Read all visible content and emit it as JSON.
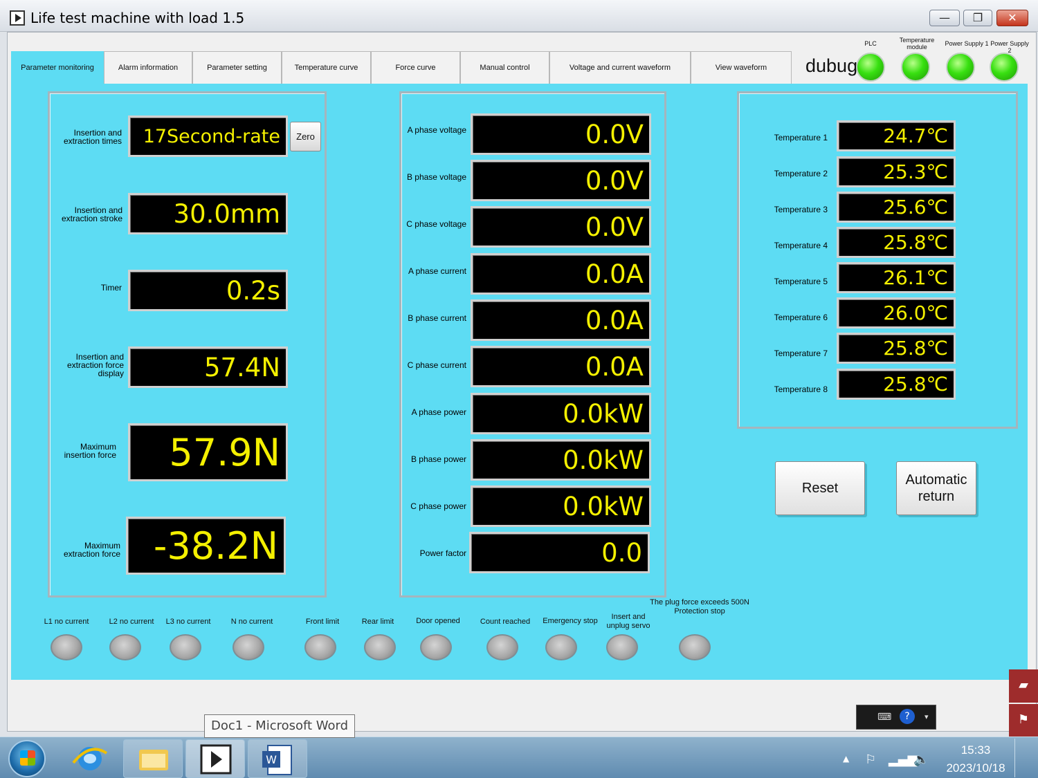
{
  "window": {
    "title": "Life test machine with load 1.5",
    "minimize_glyph": "—",
    "restore_glyph": "❐",
    "close_glyph": "✕"
  },
  "tabs": [
    {
      "label": "Parameter monitoring",
      "active": true
    },
    {
      "label": "Alarm information"
    },
    {
      "label": "Parameter setting"
    },
    {
      "label": "Temperature curve"
    },
    {
      "label": "Force curve"
    },
    {
      "label": "Manual control"
    },
    {
      "label": "Voltage and current waveform"
    },
    {
      "label": "View waveform"
    }
  ],
  "status": {
    "debug_text": "dubug",
    "plc_label": "PLC",
    "temp_module_label": "Temperature module",
    "psu1_label": "Power Supply 1",
    "psu2_label": "Power Supply 2",
    "led_color": "#38e011"
  },
  "left": {
    "insertion_times_label": "Insertion and extraction times",
    "insertion_times_value": "17Second-rate",
    "zero_label": "Zero",
    "stroke_label": "Insertion and extraction stroke",
    "stroke_value": "30.0mm",
    "timer_label": "Timer",
    "timer_value": "0.2s",
    "force_display_label": "Insertion and extraction force display",
    "force_display_value": "57.4N",
    "max_insertion_label": "Maximum insertion force",
    "max_insertion_value": "57.9N",
    "max_extraction_label": "Maximum extraction force",
    "max_extraction_value": "-38.2N"
  },
  "electrical": [
    {
      "label": "A phase voltage",
      "value": "0.0V"
    },
    {
      "label": "B phase voltage",
      "value": "0.0V"
    },
    {
      "label": "C phase voltage",
      "value": "0.0V"
    },
    {
      "label": "A phase current",
      "value": "0.0A"
    },
    {
      "label": "B phase current",
      "value": "0.0A"
    },
    {
      "label": "C phase current",
      "value": "0.0A"
    },
    {
      "label": "A phase power",
      "value": "0.0kW"
    },
    {
      "label": "B phase power",
      "value": "0.0kW"
    },
    {
      "label": "C phase power",
      "value": "0.0kW"
    },
    {
      "label": "Power factor",
      "value": "0.0"
    }
  ],
  "temperatures": [
    {
      "label": "Temperature 1",
      "value": "24.7℃"
    },
    {
      "label": "Temperature 2",
      "value": "25.3℃"
    },
    {
      "label": "Temperature 3",
      "value": "25.6℃"
    },
    {
      "label": "Temperature 4",
      "value": "25.8℃"
    },
    {
      "label": "Temperature 5",
      "value": "26.1℃"
    },
    {
      "label": "Temperature 6",
      "value": "26.0℃"
    },
    {
      "label": "Temperature 7",
      "value": "25.8℃"
    },
    {
      "label": "Temperature 8",
      "value": "25.8℃"
    }
  ],
  "buttons": {
    "reset": "Reset",
    "auto_return": "Automatic\nreturn"
  },
  "indicators": [
    {
      "label": "L1 no current"
    },
    {
      "label": "L2 no current"
    },
    {
      "label": "L3 no current"
    },
    {
      "label": "N no current"
    },
    {
      "label": "Front limit"
    },
    {
      "label": "Rear limit"
    },
    {
      "label": "Door opened"
    },
    {
      "label": "Count reached"
    },
    {
      "label": "Emergency stop"
    },
    {
      "label": "Insert and unplug servo"
    },
    {
      "label": "The plug force exceeds 500N Protection stop"
    }
  ],
  "taskbar": {
    "tooltip": "Doc1 - Microsoft Word",
    "time": "15:33",
    "date": "2023/10/18"
  },
  "colors": {
    "panel_bg": "#5ddcf3",
    "display_bg": "#000000",
    "display_text": "#f4f000"
  }
}
